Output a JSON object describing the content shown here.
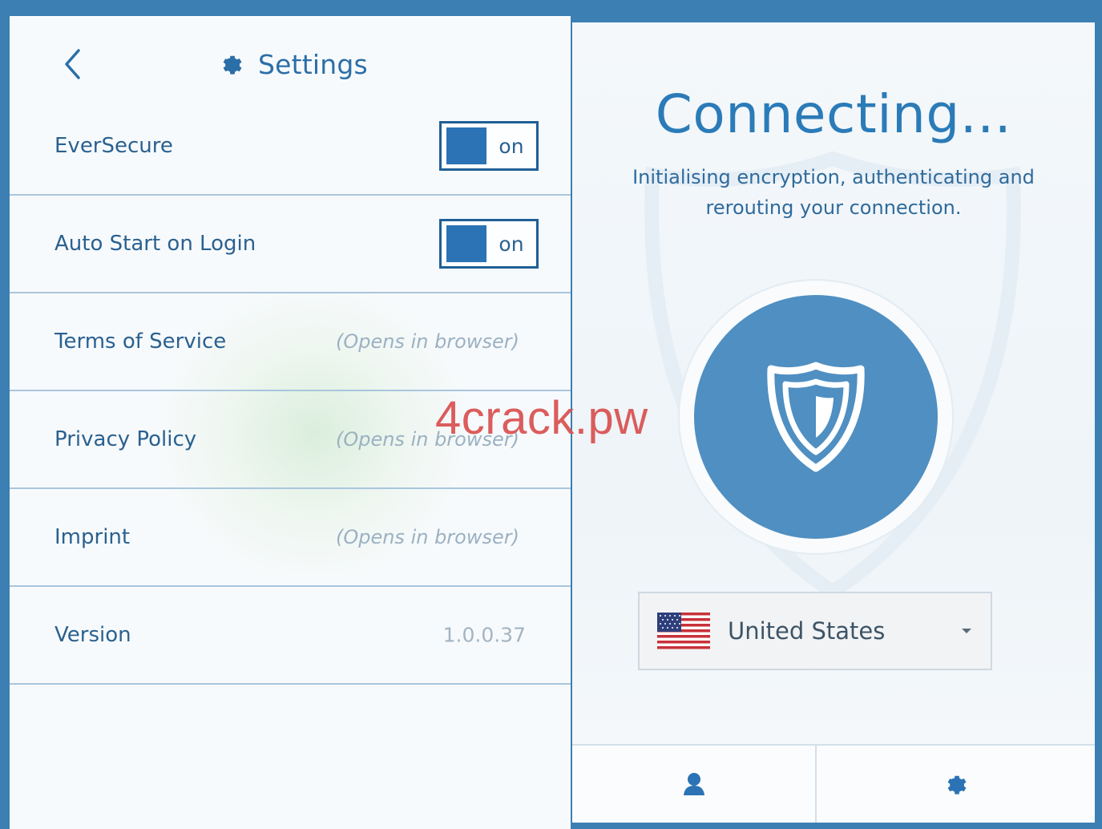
{
  "settings": {
    "title": "Settings",
    "back_icon": "chevron-left-icon",
    "title_icon": "gear-icon",
    "rows": [
      {
        "label": "EverSecure",
        "type": "toggle",
        "toggle_text": "on",
        "enabled": true
      },
      {
        "label": "Auto Start on Login",
        "type": "toggle",
        "toggle_text": "on",
        "enabled": true
      },
      {
        "label": "Terms of Service",
        "type": "link",
        "value": "(Opens in browser)"
      },
      {
        "label": "Privacy Policy",
        "type": "link",
        "value": "(Opens in browser)"
      },
      {
        "label": "Imprint",
        "type": "link",
        "value": "(Opens in browser)"
      },
      {
        "label": "Version",
        "type": "info",
        "value": "1.0.0.37"
      }
    ]
  },
  "connect": {
    "title": "Connecting...",
    "subtitle_line1": "Initialising encryption, authenticating and",
    "subtitle_line2": "rerouting your connection.",
    "button_icon": "shield-icon",
    "country": "United States",
    "country_flag": "us-flag-icon",
    "dropdown_icon": "caret-down-icon",
    "bottom_bar": [
      {
        "icon": "user-icon"
      },
      {
        "icon": "gear-icon"
      }
    ]
  },
  "watermark": "4crack.pw",
  "colors": {
    "accent": "#2b73b5",
    "frame": "#3b7fb3",
    "connect_button": "#4f8fc2",
    "watermark": "#d9504f"
  }
}
